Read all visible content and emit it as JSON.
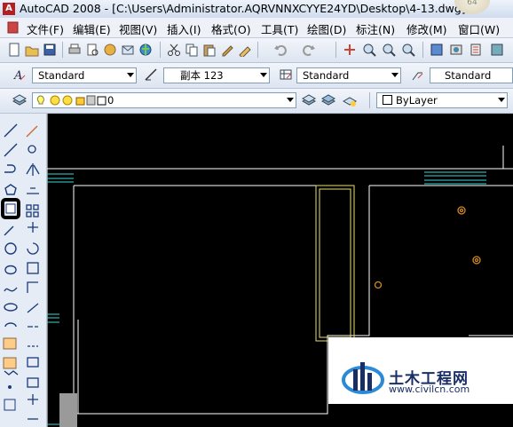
{
  "window": {
    "title": "AutoCAD 2008 - [C:\\Users\\Administrator.AQRVNNXCYYE24YD\\Desktop\\4-13.dwg]",
    "app_logo": "A",
    "badge": "64"
  },
  "menu": [
    "文件(F)",
    "编辑(E)",
    "视图(V)",
    "插入(I)",
    "格式(O)",
    "工具(T)",
    "绘图(D)",
    "标注(N)",
    "修改(M)",
    "窗口(W)"
  ],
  "styles_toolbar": {
    "text_style": "Standard",
    "dim_style": "副本 123",
    "table_style": "Standard",
    "multileader_style": "Standard"
  },
  "layers_toolbar": {
    "current_layer": "0",
    "color": "ByLayer"
  },
  "watermark": {
    "title": "土木工程网",
    "url": "www.civilcn.com"
  },
  "colors": {
    "cad_background": "#000000",
    "line_white": "#ffffff",
    "line_cyan": "#3ad8d8",
    "line_yellow": "#e8e070",
    "marker_orange": "#d08a20"
  }
}
